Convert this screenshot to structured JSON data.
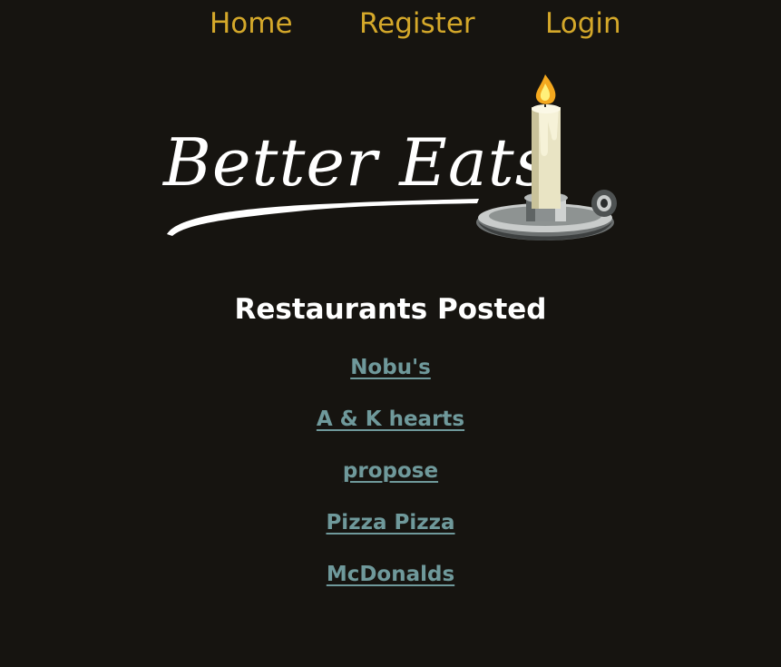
{
  "nav": {
    "home": "Home",
    "register": "Register",
    "login": "Login"
  },
  "logo": {
    "text": "Better Eats",
    "icon": "candle-icon"
  },
  "heading": "Restaurants Posted",
  "restaurants": [
    "Nobu's",
    "A & K hearts",
    "propose",
    "Pizza Pizza",
    "McDonalds"
  ],
  "colors": {
    "background": "#161410",
    "nav_link": "#d4a82a",
    "heading": "#ffffff",
    "restaurant_link": "#6f999b"
  }
}
